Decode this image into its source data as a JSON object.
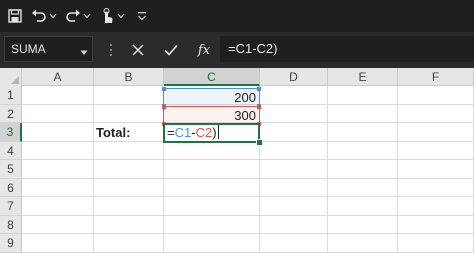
{
  "qat": {
    "save_icon": "save-icon",
    "undo_icon": "undo-icon",
    "redo_icon": "redo-icon",
    "touch_icon": "touch-mode-icon",
    "customize_icon": "customize-qat-icon"
  },
  "formula_bar": {
    "name_box": "SUMA",
    "cancel_icon": "cancel-icon",
    "enter_icon": "check-icon",
    "fx_label": "fx",
    "formula": "=C1-C2)"
  },
  "grid": {
    "columns": [
      "A",
      "B",
      "C",
      "D",
      "E",
      "F"
    ],
    "selected_column": "C",
    "rows": [
      "1",
      "2",
      "3",
      "4",
      "5",
      "6",
      "7",
      "8",
      "9"
    ],
    "selected_row": "3",
    "cells": {
      "C1": "200",
      "C2": "300",
      "B3": "Total:"
    },
    "editing": {
      "cell": "C3",
      "prefix": "=",
      "ref1": "C1",
      "op": "-",
      "ref2": "C2",
      "suffix": ")"
    }
  },
  "colors": {
    "accent": "#217346",
    "ref1": "#4a90d9",
    "ref2": "#d9534f",
    "chrome": "#1f1f1f"
  }
}
